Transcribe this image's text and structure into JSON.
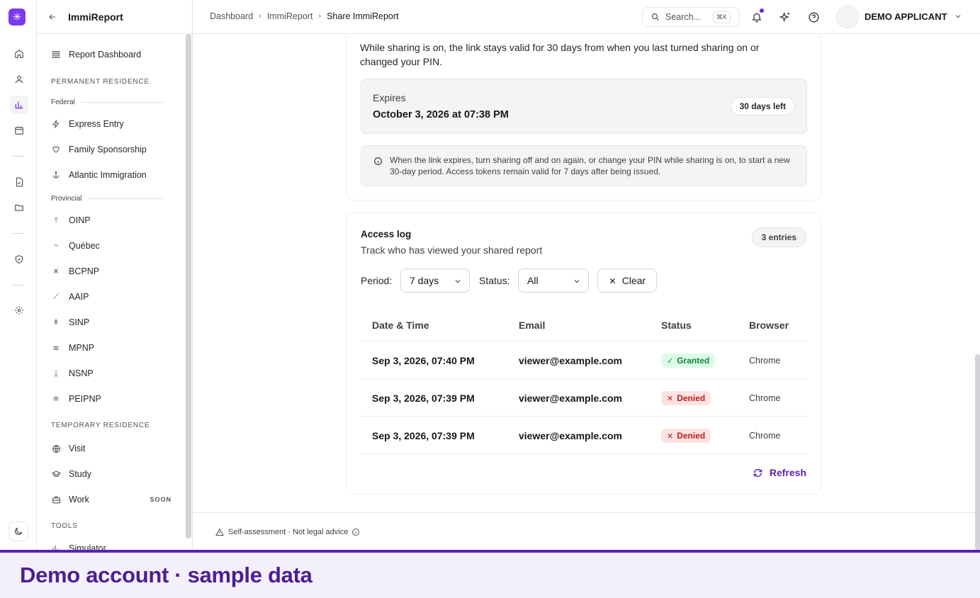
{
  "sidebar": {
    "title": "ImmiReport",
    "items": {
      "report_dashboard": "Report Dashboard",
      "permanent_residence": "PERMANENT RESIDENCE",
      "federal": "Federal",
      "express_entry": "Express Entry",
      "family_sponsorship": "Family Sponsorship",
      "atlantic_immigration": "Atlantic Immigration",
      "provincial": "Provincial",
      "oinp": "OINP",
      "quebec": "Québec",
      "bcpnp": "BCPNP",
      "aaip": "AAIP",
      "sinp": "SINP",
      "mpnp": "MPNP",
      "nsnp": "NSNP",
      "peipnp": "PEIPNP",
      "temporary_residence": "TEMPORARY RESIDENCE",
      "visit": "Visit",
      "study": "Study",
      "work": "Work",
      "work_badge": "SOON",
      "tools": "TOOLS",
      "simulator": "Simulator"
    }
  },
  "breadcrumb": [
    "Dashboard",
    "ImmiReport",
    "Share ImmiReport"
  ],
  "search": {
    "placeholder": "Search...",
    "shortcut": "⌘K"
  },
  "user": {
    "name": "DEMO APPLICANT"
  },
  "validity": {
    "description": "While sharing is on, the link stays valid for 30 days from when you last turned sharing on or changed your PIN.",
    "expires_label": "Expires",
    "expires_date": "October 3, 2026 at 07:38 PM",
    "days_left": "30 days left",
    "info": "When the link expires, turn sharing off and on again, or change your PIN while sharing is on, to start a new 30-day period. Access tokens remain valid for 7 days after being issued."
  },
  "access_log": {
    "title": "Access log",
    "subtitle": "Track who has viewed your shared report",
    "entries_badge": "3 entries",
    "period_label": "Period:",
    "period_value": "7 days",
    "status_label": "Status:",
    "status_value": "All",
    "clear_label": "Clear",
    "columns": [
      "Date & Time",
      "Email",
      "Status",
      "Browser"
    ],
    "rows": [
      {
        "datetime": "Sep 3, 2026, 07:40 PM",
        "email": "viewer@example.com",
        "status": "Granted",
        "browser": "Chrome"
      },
      {
        "datetime": "Sep 3, 2026, 07:39 PM",
        "email": "viewer@example.com",
        "status": "Denied",
        "browser": "Chrome"
      },
      {
        "datetime": "Sep 3, 2026, 07:39 PM",
        "email": "viewer@example.com",
        "status": "Denied",
        "browser": "Chrome"
      }
    ],
    "refresh_label": "Refresh"
  },
  "footer": {
    "text": "Self-assessment · Not legal advice"
  },
  "banner": {
    "text": "Demo account · sample data"
  },
  "colors": {
    "accent": "#6d28d9",
    "granted": "#15803d",
    "denied": "#b91c1c"
  }
}
